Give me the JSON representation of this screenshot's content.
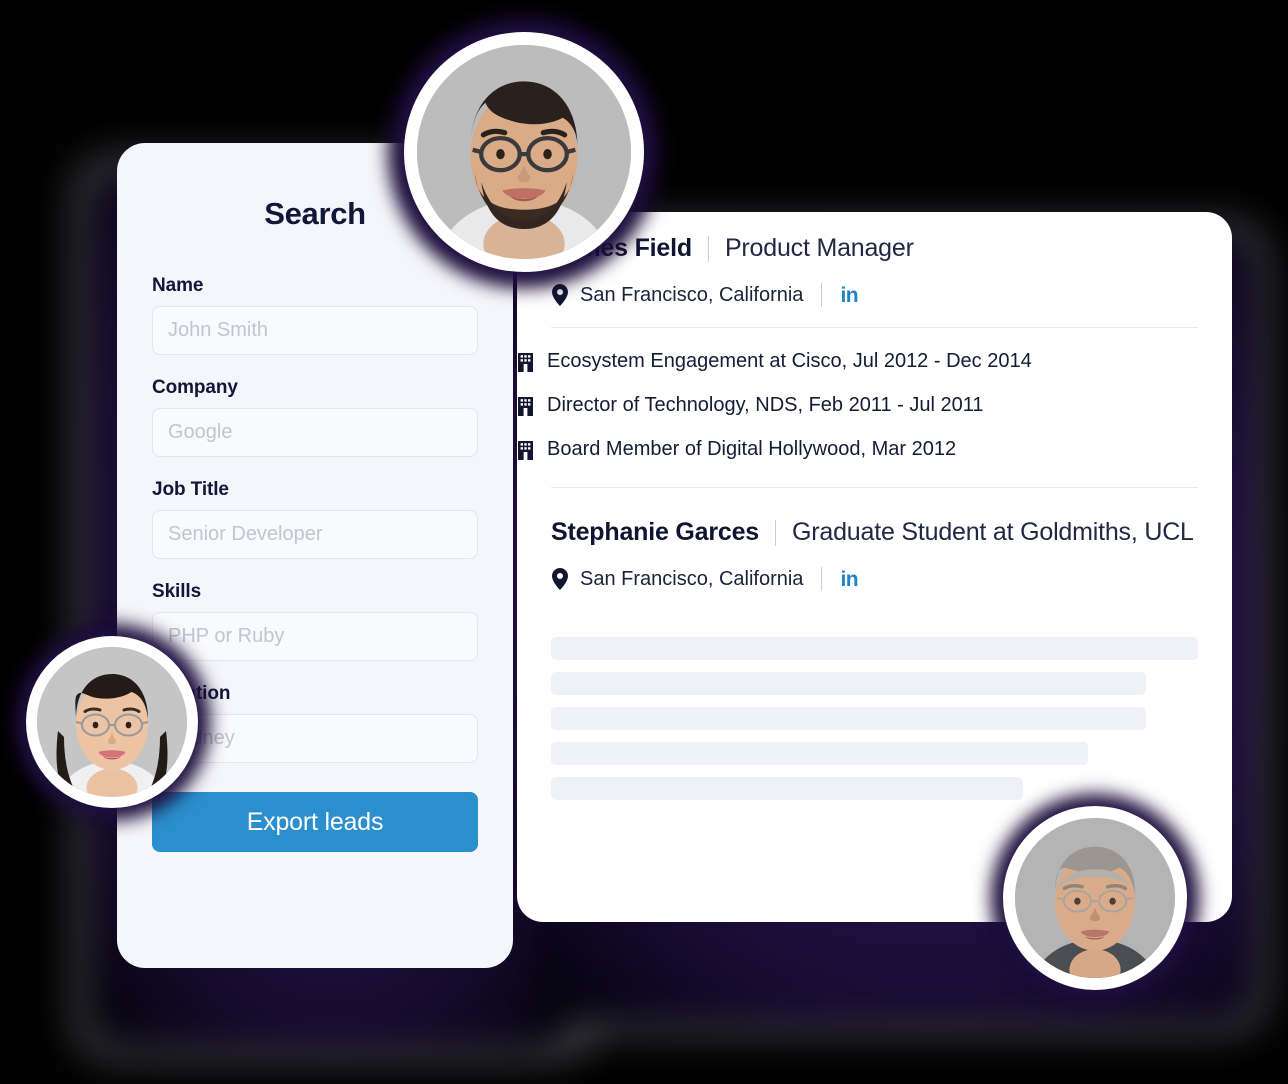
{
  "search_panel": {
    "title": "Search",
    "fields": [
      {
        "label": "Name",
        "placeholder": "John Smith",
        "value": ""
      },
      {
        "label": "Company",
        "placeholder": "Google",
        "value": ""
      },
      {
        "label": "Job Title",
        "placeholder": "Senior Developer",
        "value": ""
      },
      {
        "label": "Skills",
        "placeholder": "PHP or Ruby",
        "value": ""
      },
      {
        "label": "Location",
        "placeholder": "Sydney",
        "value": ""
      }
    ],
    "export_button": "Export leads"
  },
  "results": [
    {
      "name": "James Field",
      "title": "Product Manager",
      "location": "San Francisco, California",
      "linkedin_label": "in",
      "experience": [
        "Ecosystem Engagement at Cisco, Jul 2012 - Dec 2014",
        "Director of Technology, NDS, Feb 2011 - Jul 2011",
        "Board Member of Digital Hollywood, Mar 2012"
      ]
    },
    {
      "name": "Stephanie Garces",
      "title": "Graduate Student at Goldmiths, UCL",
      "location": "San Francisco, California",
      "linkedin_label": "in",
      "experience": []
    }
  ],
  "skeleton_widths": [
    "100%",
    "92%",
    "92%",
    "83%",
    "73%"
  ],
  "avatars": [
    {
      "name": "avatar-top",
      "alt": "bearded man with glasses"
    },
    {
      "name": "avatar-left",
      "alt": "woman with glasses"
    },
    {
      "name": "avatar-right",
      "alt": "grey haired man"
    }
  ],
  "colors": {
    "accent_blue": "#2b8ecd",
    "linkedin_blue": "#2183c4",
    "panel_light": "#f5f6fb",
    "panel_white": "#ffffff",
    "text_dark": "#121737",
    "skeleton": "#eff0f8",
    "glow_purple": "#2a1355"
  }
}
